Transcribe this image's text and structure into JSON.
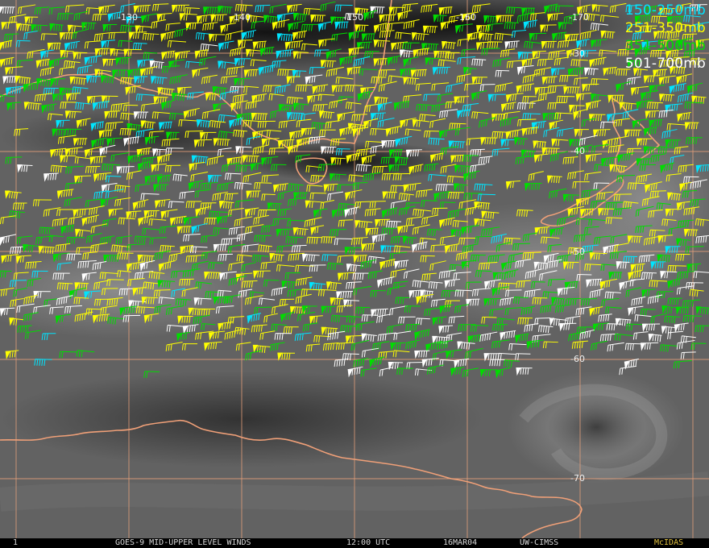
{
  "map": {
    "longitude_labels": [
      {
        "value": -130,
        "text": "-130"
      },
      {
        "value": -140,
        "text": "-140"
      },
      {
        "value": -150,
        "text": "-150"
      },
      {
        "value": -160,
        "text": "-160"
      },
      {
        "value": -170,
        "text": "-170"
      }
    ],
    "latitude_labels": [
      {
        "value": -30,
        "text": "-30"
      },
      {
        "value": -40,
        "text": "-40"
      },
      {
        "value": -50,
        "text": "-50"
      },
      {
        "value": -60,
        "text": "-60"
      },
      {
        "value": -70,
        "text": "-70"
      }
    ],
    "grid_color": "#e8a07a",
    "coast_color": "#f0a078"
  },
  "legend": [
    {
      "text": "150-250mb",
      "color": "#00e5ff"
    },
    {
      "text": "251-350mb",
      "color": "#ffff00"
    },
    {
      "text": "351-500mb",
      "color": "#00dd00"
    },
    {
      "text": "501-700mb",
      "color": "#ffffff"
    }
  ],
  "status": {
    "frame": "1",
    "product": "GOES-9 MID-UPPER LEVEL WINDS",
    "time": "12:00 UTC",
    "date": "16MAR04",
    "source": "UW-CIMSS",
    "brand": "McIDAS",
    "brand_color": "#e0c040"
  }
}
